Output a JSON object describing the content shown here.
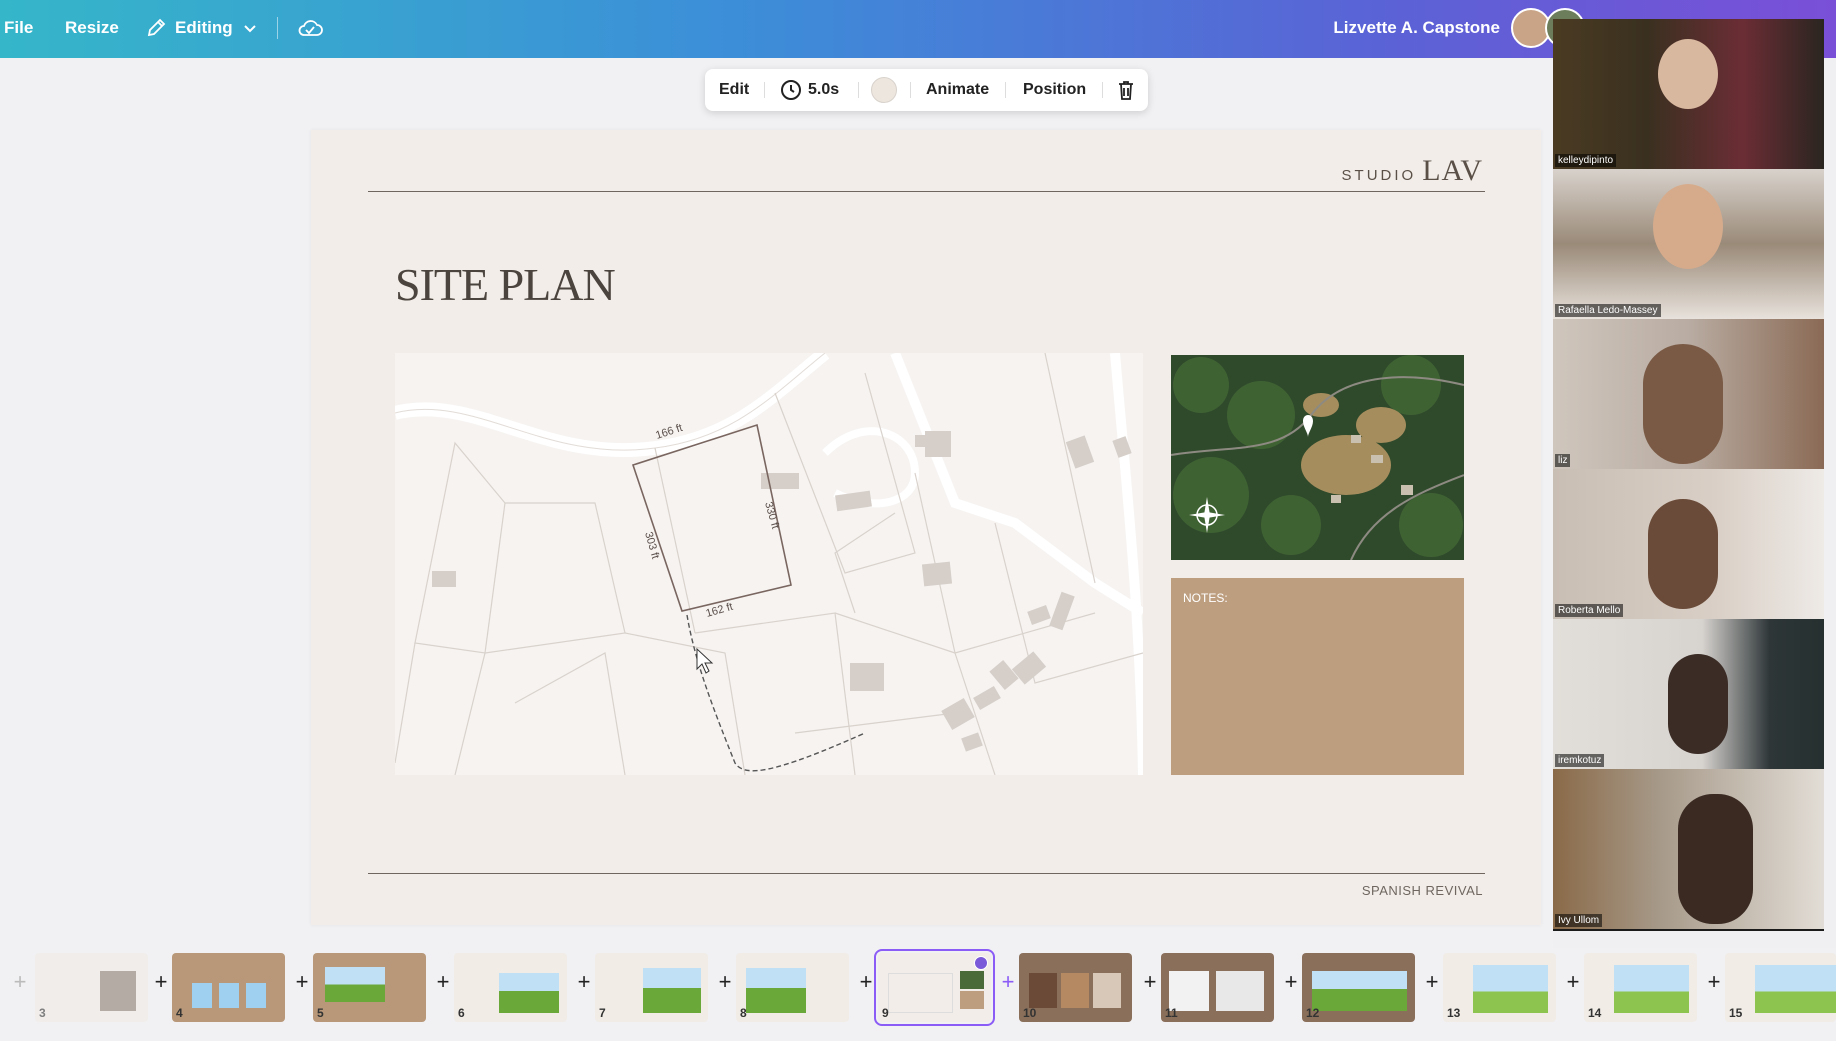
{
  "topbar": {
    "file": "File",
    "resize": "Resize",
    "editing": "Editing",
    "user_name": "Lizvette A. Capstone"
  },
  "element_toolbar": {
    "edit": "Edit",
    "duration": "5.0s",
    "animate": "Animate",
    "position": "Position"
  },
  "slide": {
    "brand_small": "STUDIO",
    "brand_large": "LAV",
    "title": "SITE PLAN",
    "notes_label": "NOTES:",
    "footer": "SPANISH REVIVAL",
    "map_labels": {
      "top": "166 ft",
      "right": "330 ft",
      "left": "303 ft",
      "bottom": "162 ft"
    }
  },
  "participants": [
    {
      "name": "kelleydipinto",
      "bg": "#3a3020"
    },
    {
      "name": "Rafaella Ledo-Massey",
      "bg": "#8a7a68"
    },
    {
      "name": "liz",
      "bg": "#b9aca2"
    },
    {
      "name": "Roberta Mello",
      "bg": "#c9beb3"
    },
    {
      "name": "iremkotuz",
      "bg": "#d7d3cf"
    },
    {
      "name": "Ivy Ullom",
      "bg": "#a79a8a"
    }
  ],
  "filmstrip": {
    "pages": [
      "3",
      "4",
      "5",
      "6",
      "7",
      "8",
      "9",
      "10",
      "11",
      "12",
      "13",
      "14",
      "15"
    ],
    "active_page": "9"
  }
}
